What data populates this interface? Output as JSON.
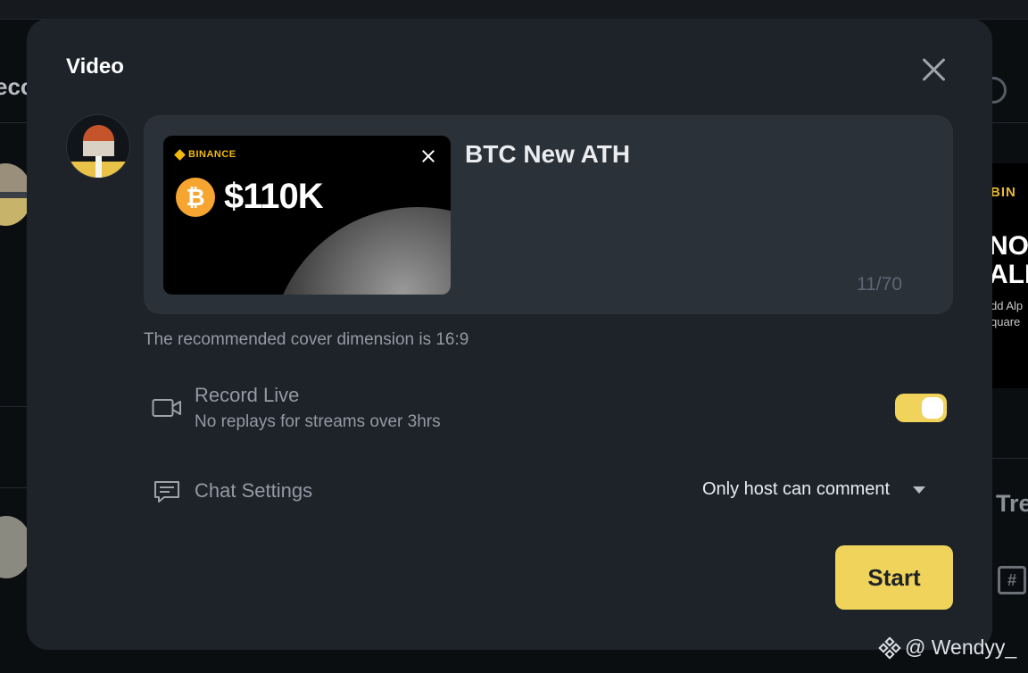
{
  "background": {
    "left_heading_fragment": "eco",
    "right_card": {
      "brand_fragment": "BIN",
      "headline_fragment_1": "NOV",
      "headline_fragment_2": "ALI",
      "line_1": "dd Alp",
      "line_2": "quare"
    },
    "trending_fragment": "Tre",
    "hash_glyph": "#"
  },
  "modal": {
    "title": "Video",
    "close_icon": "close-icon",
    "cover": {
      "brand": "BINANCE",
      "coin_symbol": "₿",
      "price": "$110K"
    },
    "stream_title": "BTC New ATH",
    "char_count": "11/70",
    "cover_hint": "The recommended cover dimension is 16:9",
    "record": {
      "label": "Record Live",
      "sublabel": "No replays for streams over 3hrs",
      "enabled": true
    },
    "chat": {
      "label": "Chat Settings",
      "selected": "Only host can comment"
    },
    "start_label": "Start"
  },
  "watermark": {
    "text": "@ Wendyy_"
  },
  "colors": {
    "accent": "#f0d35a",
    "modal_bg": "#1e2329",
    "panel_bg": "#2b3139",
    "muted_text": "#929aa5"
  }
}
